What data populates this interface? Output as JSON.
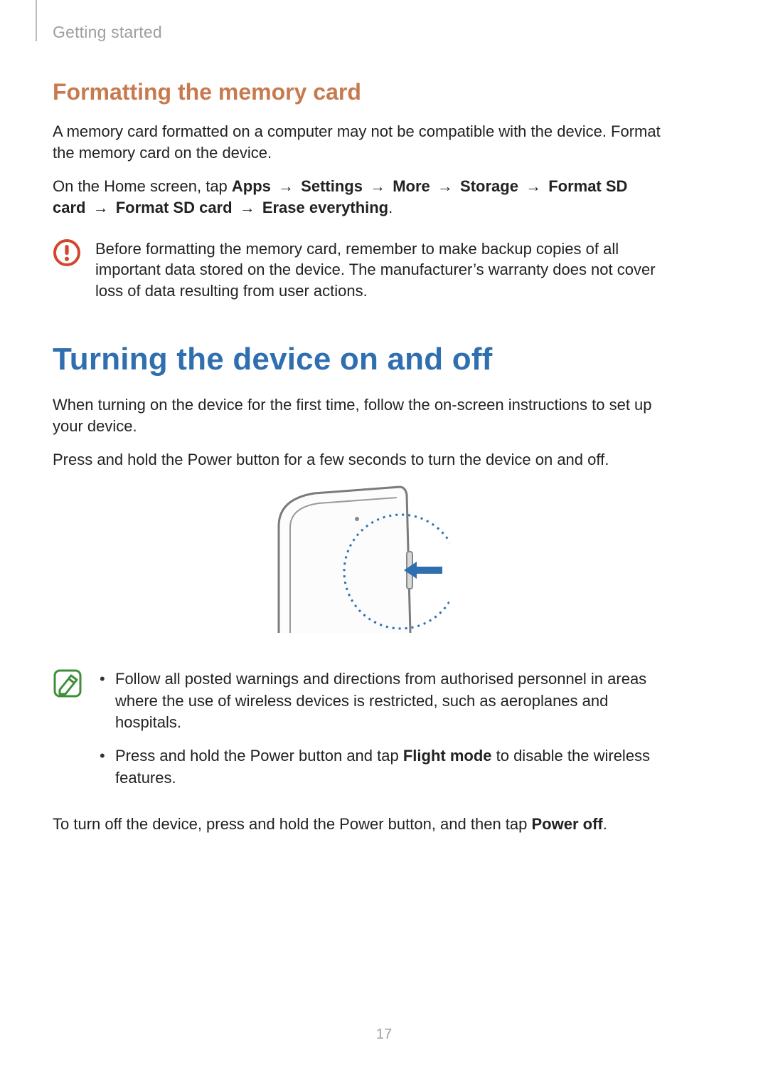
{
  "header": {
    "section": "Getting started"
  },
  "sec1": {
    "heading": "Formatting the memory card",
    "p1": "A memory card formatted on a computer may not be compatible with the device. Format the memory card on the device.",
    "p2_lead": "On the Home screen, tap ",
    "path": {
      "s1": "Apps",
      "s2": "Settings",
      "s3": "More",
      "s4": "Storage",
      "s5": "Format SD card",
      "s6": "Format SD card",
      "s7": "Erase everything"
    },
    "period": ".",
    "caution": "Before formatting the memory card, remember to make backup copies of all important data stored on the device. The manufacturer’s warranty does not cover loss of data resulting from user actions."
  },
  "sec2": {
    "heading": "Turning the device on and off",
    "p1": "When turning on the device for the first time, follow the on-screen instructions to set up your device.",
    "p2": "Press and hold the Power button for a few seconds to turn the device on and off.",
    "bullets": {
      "b1": "Follow all posted warnings and directions from authorised personnel in areas where the use of wireless devices is restricted, such as aeroplanes and hospitals.",
      "b2_pre": "Press and hold the Power button and tap ",
      "b2_bold": "Flight mode",
      "b2_post": " to disable the wireless features."
    },
    "p3_pre": "To turn off the device, press and hold the Power button, and then tap ",
    "p3_bold": "Power off",
    "p3_post": "."
  },
  "arrow": "→",
  "page_number": "17",
  "icons": {
    "caution": "caution-icon",
    "note": "note-icon",
    "device": "device-power-illustration"
  }
}
